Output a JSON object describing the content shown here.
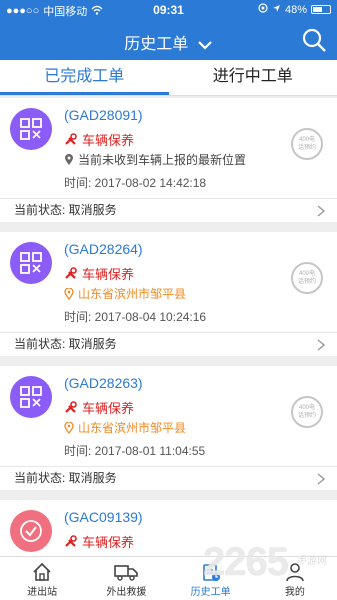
{
  "statusbar": {
    "carrier": "中国移动",
    "time": "09:31",
    "battery": "48%"
  },
  "header": {
    "title": "历史工单"
  },
  "tabs": [
    {
      "label": "已完成工单"
    },
    {
      "label": "进行中工单"
    }
  ],
  "orders": [
    {
      "code": "(GAD28091)",
      "service": "车辆保养",
      "location": "当前未收到车辆上报的最新位置",
      "time": "时间: 2017-08-02 14:42:18",
      "status": "当前状态: 取消服务",
      "stamp_top": "400电",
      "stamp_bottom": "话预约"
    },
    {
      "code": "(GAD28264)",
      "service": "车辆保养",
      "location": "山东省滨州市邹平县",
      "time": "时间: 2017-08-04 10:24:16",
      "status": "当前状态: 取消服务",
      "stamp_top": "400电",
      "stamp_bottom": "话预约"
    },
    {
      "code": "(GAD28263)",
      "service": "车辆保养",
      "location": "山东省滨州市邹平县",
      "time": "时间: 2017-08-01 11:04:55",
      "status": "当前状态: 取消服务",
      "stamp_top": "400电",
      "stamp_bottom": "话预约"
    },
    {
      "code": "(GAC09139)",
      "service": "车辆保养"
    }
  ],
  "tabbar": [
    {
      "label": "进出站"
    },
    {
      "label": "外出救援"
    },
    {
      "label": "历史工单"
    },
    {
      "label": "我的"
    }
  ],
  "watermark": {
    "big": "2265",
    "small": "手游网"
  },
  "colors": {
    "primary": "#2b7ad6",
    "service_red": "#e02020",
    "address_orange": "#f08a24",
    "avatar_purple": "#8b5cf6",
    "avatar_pink": "#f07080"
  }
}
